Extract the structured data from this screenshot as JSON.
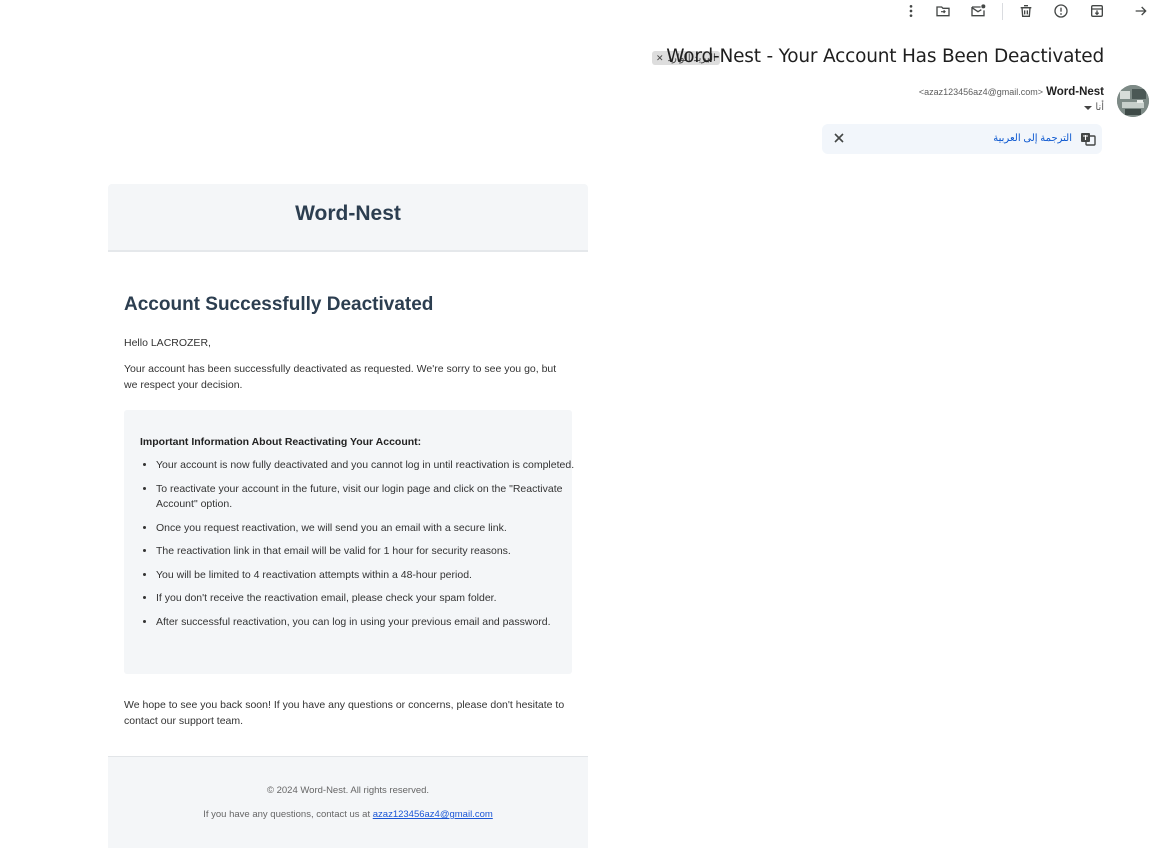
{
  "subject": "Word-Nest - Your Account Has Been Deactivated",
  "label": "البريد الوارد",
  "sender": {
    "name": "Word-Nest",
    "email": "<azaz123456az4@gmail.com>"
  },
  "recipient": "أنا",
  "translate": {
    "link": "الترجمة إلى العربية"
  },
  "email": {
    "brand": "Word-Nest",
    "title": "Account Successfully Deactivated",
    "greeting": "Hello LACROZER,",
    "intro": "Your account has been successfully deactivated as requested. We're sorry to see you go, but we respect your decision.",
    "info_title": "Important Information About Reactivating Your Account:",
    "info_items": [
      "Your account is now fully deactivated and you cannot log in until reactivation is completed.",
      "To reactivate your account in the future, visit our login page and click on the \"Reactivate Account\" option.",
      "Once you request reactivation, we will send you an email with a secure link.",
      "The reactivation link in that email will be valid for 1 hour for security reasons.",
      "You will be limited to 4 reactivation attempts within a 48-hour period.",
      "If you don't receive the reactivation email, please check your spam folder.",
      "After successful reactivation, you can log in using your previous email and password."
    ],
    "closing": "We hope to see you back soon! If you have any questions or concerns, please don't hesitate to contact our support team.",
    "copyright": "© 2024 Word-Nest. All rights reserved.",
    "contact_prefix": "If you have any questions, contact us at ",
    "contact_email": "azaz123456az4@gmail.com"
  },
  "icons": [
    "more-vert-icon",
    "move-to-icon",
    "mark-unread-icon",
    "delete-icon",
    "report-spam-icon",
    "archive-icon",
    "back-arrow-icon",
    "translate-icon",
    "close-icon"
  ]
}
